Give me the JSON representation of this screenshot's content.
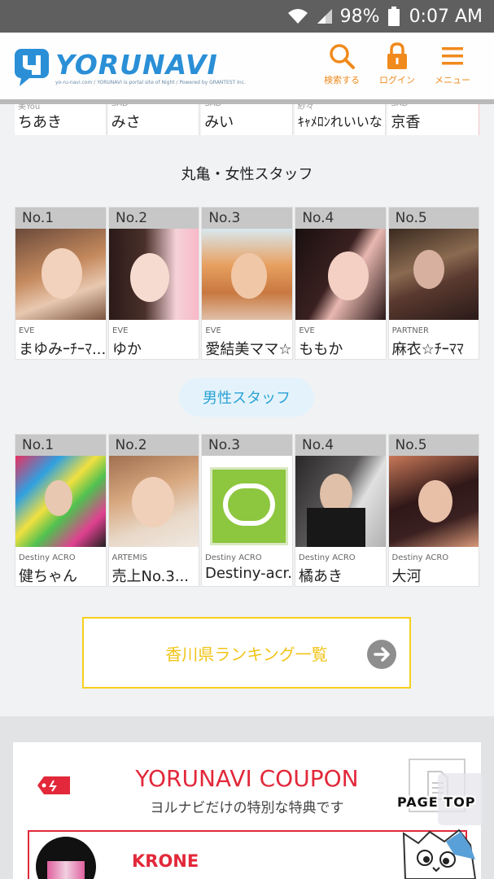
{
  "status_bar": {
    "battery": "98%",
    "time": "0:07 AM"
  },
  "header": {
    "logo_text": "YORUNAVI",
    "logo_sub": "yo-ru-navi.com / YORUNAVI is portal site of Night / Powered by GRANTEST Inc.",
    "search_label": "検索する",
    "login_label": "ログイン",
    "menu_label": "メニュー"
  },
  "top_row": [
    {
      "shop": "美You",
      "name": "ちあき"
    },
    {
      "shop": "SAD",
      "name": "みさ"
    },
    {
      "shop": "SAD",
      "name": "みい"
    },
    {
      "shop": "紗々",
      "name": "ｷｬﾒﾛﾝれいいな"
    },
    {
      "shop": "SAD",
      "name": "京香"
    }
  ],
  "female_section": {
    "title": "丸亀・女性スタッフ",
    "cards": [
      {
        "rank": "No.1",
        "shop": "EVE",
        "name": "まゆみｰﾁｰﾏ..."
      },
      {
        "rank": "No.2",
        "shop": "EVE",
        "name": "ゆか"
      },
      {
        "rank": "No.3",
        "shop": "EVE",
        "name": "愛結美ママ☆..."
      },
      {
        "rank": "No.4",
        "shop": "EVE",
        "name": "ももか"
      },
      {
        "rank": "No.5",
        "shop": "PARTNER",
        "name": "麻衣☆ﾁｰﾏﾏ"
      }
    ]
  },
  "male_section": {
    "title": "男性スタッフ",
    "cards": [
      {
        "rank": "No.1",
        "shop": "Destiny ACRO",
        "name": "健ちゃん"
      },
      {
        "rank": "No.2",
        "shop": "ARTEMIS",
        "name": "売上No.3..."
      },
      {
        "rank": "No.3",
        "shop": "Destiny ACRO",
        "name": "Destiny-acr..."
      },
      {
        "rank": "No.4",
        "shop": "Destiny ACRO",
        "name": "橘あき"
      },
      {
        "rank": "No.5",
        "shop": "Destiny ACRO",
        "name": "大河"
      }
    ]
  },
  "ranking_link": {
    "label": "香川県ランキング一覧"
  },
  "coupon": {
    "title": "YORUNAVI COUPON",
    "subtitle": "ヨルナビだけの特別な特典です",
    "shop_name": "KRONE"
  },
  "page_top": {
    "label": "PAGE TOP"
  },
  "colors": {
    "accent_orange": "#f08a1c",
    "logo_blue": "#2a8fd6",
    "coupon_red": "#e2283a",
    "link_yellow": "#f2c418",
    "male_blue": "#2aa2d5"
  }
}
